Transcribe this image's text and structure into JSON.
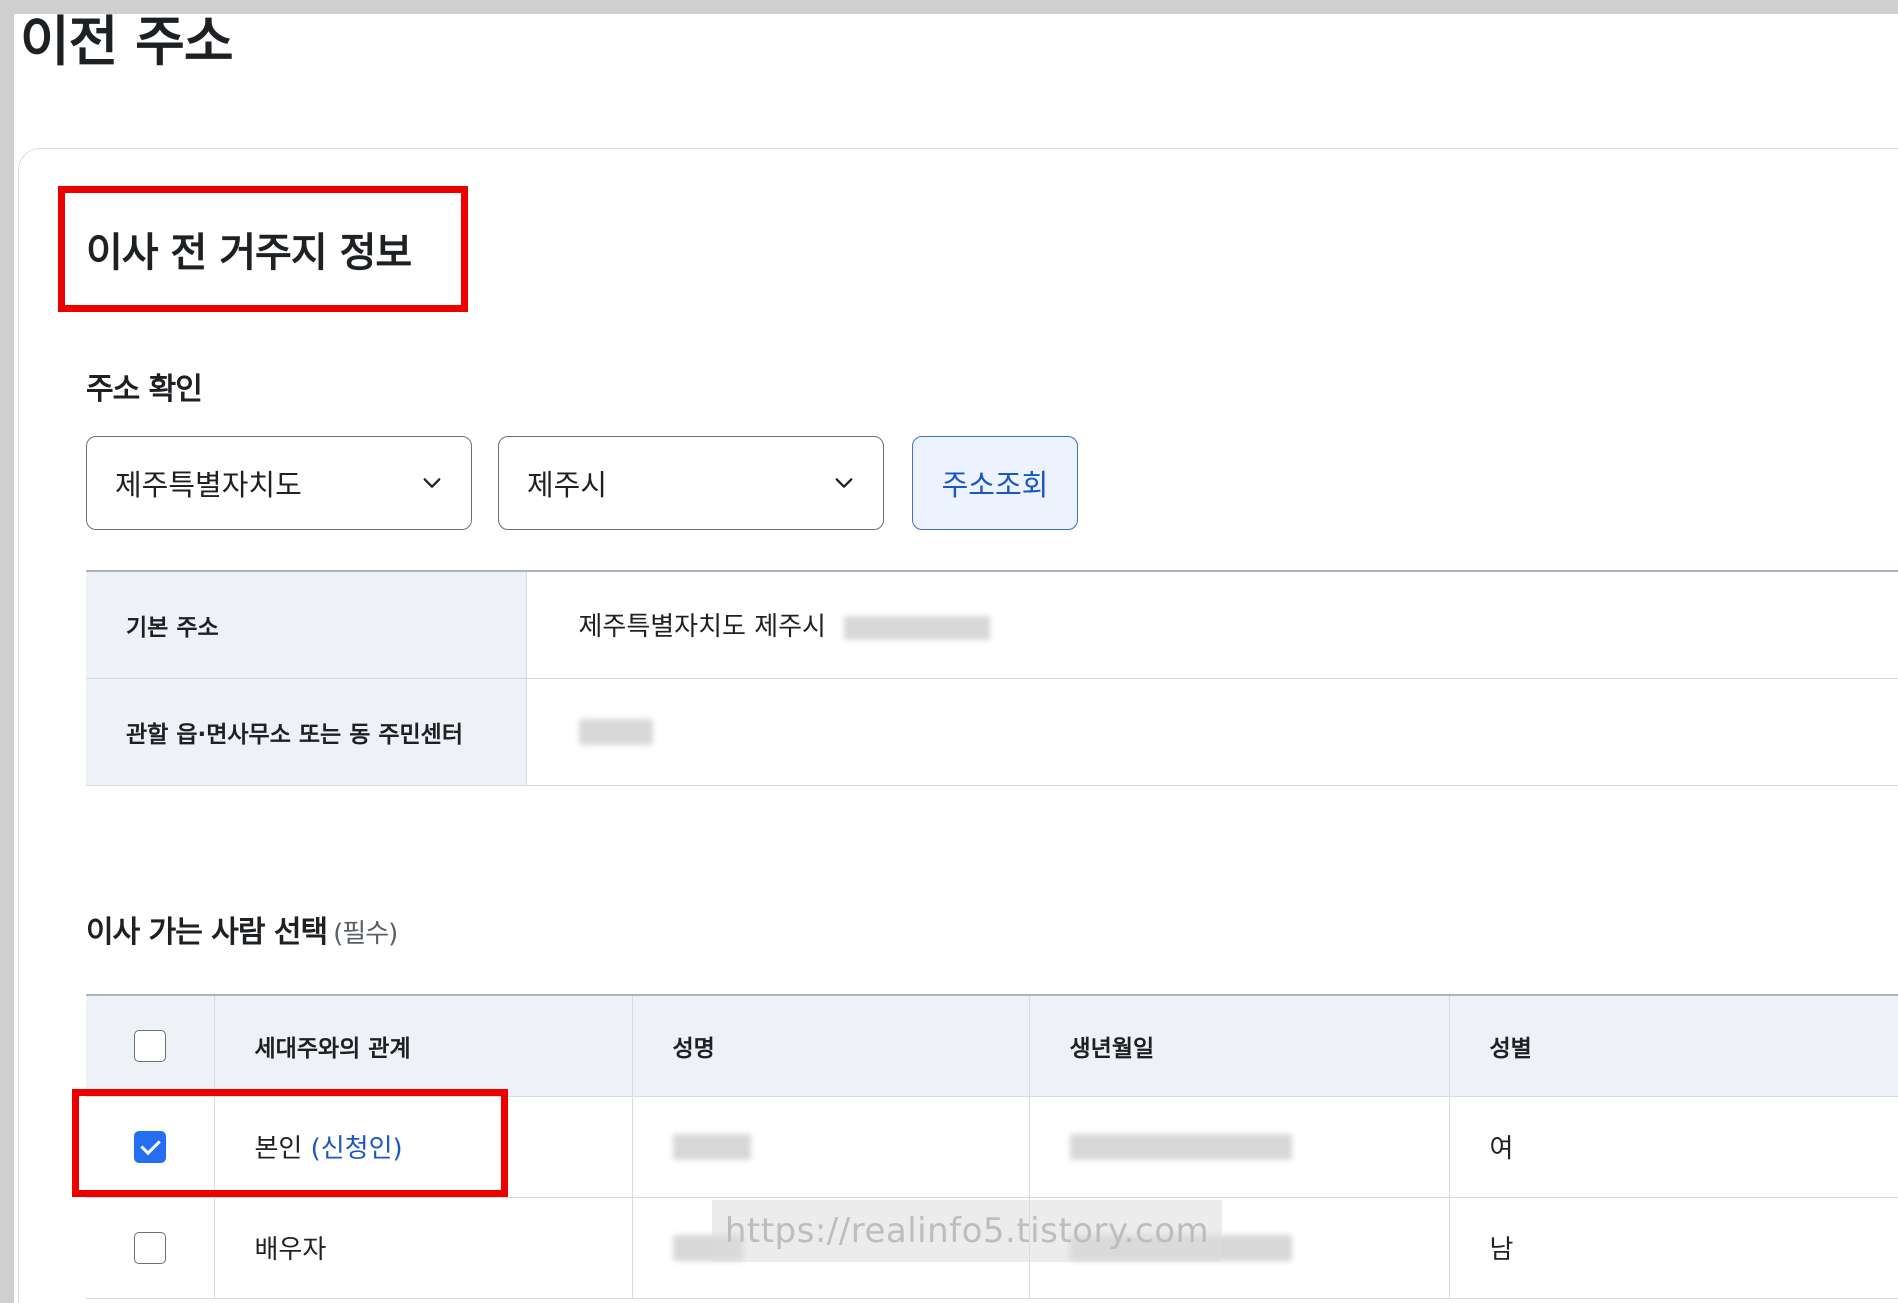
{
  "page": {
    "title": "이전 주소"
  },
  "section": {
    "title": "이사 전 거주지 정보"
  },
  "address_check": {
    "title": "주소 확인",
    "province_select": "제주특별자치도",
    "city_select": "제주시",
    "search_button": "주소조회"
  },
  "address_info": {
    "rows": [
      {
        "label": "기본 주소",
        "value": "제주특별자치도 제주시"
      },
      {
        "label": "관할 읍·면사무소 또는 동 주민센터",
        "value": ""
      }
    ]
  },
  "people": {
    "title": "이사 가는 사람 선택",
    "required": "(필수)",
    "columns": [
      "세대주와의 관계",
      "성명",
      "생년월일",
      "성별"
    ],
    "rows": [
      {
        "relation": "본인",
        "relation_note": "(신청인)",
        "gender": "여",
        "checked": true
      },
      {
        "relation": "배우자",
        "relation_note": "",
        "gender": "남",
        "checked": false
      }
    ]
  },
  "watermark": "https://realinfo5.tistory.com",
  "colors": {
    "highlight": "#ec0000",
    "accent": "#256ef4",
    "link": "#1a56c4"
  }
}
